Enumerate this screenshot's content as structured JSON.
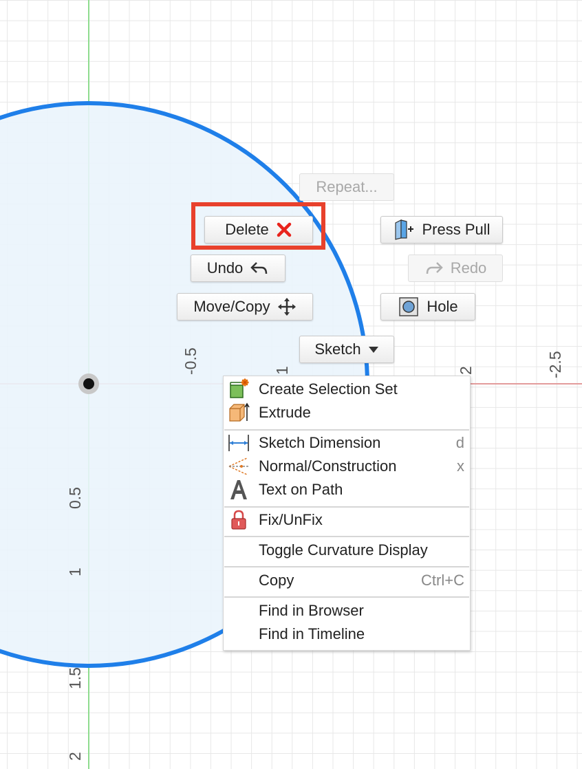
{
  "canvas": {
    "axis_labels": {
      "x": [
        "-0.5",
        "1",
        "2",
        "-2.5"
      ],
      "y": [
        "0.5",
        "1",
        "1.5",
        "2"
      ]
    },
    "colors": {
      "circle_stroke": "#1f7fe9",
      "circle_fill": "#eaf4fc",
      "vertical_axis": "#8fdc8f",
      "horizontal_axis": "#e39b9b",
      "grid": "#e7e7e7"
    }
  },
  "marking_menu": {
    "repeat": "Repeat...",
    "delete": "Delete",
    "press_pull": "Press Pull",
    "undo": "Undo",
    "redo": "Redo",
    "move_copy": "Move/Copy",
    "hole": "Hole",
    "sketch": "Sketch",
    "highlight_color": "#e8412c"
  },
  "context_menu": {
    "items": [
      {
        "label": "Create Selection Set",
        "shortcut": "",
        "icon": "selection-set-icon"
      },
      {
        "label": "Extrude",
        "shortcut": "",
        "icon": "extrude-icon"
      },
      {
        "label": "Sketch Dimension",
        "shortcut": "d",
        "icon": "dimension-icon"
      },
      {
        "label": "Normal/Construction",
        "shortcut": "x",
        "icon": "construction-icon"
      },
      {
        "label": "Text on Path",
        "shortcut": "",
        "icon": "text-icon"
      },
      {
        "label": "Fix/UnFix",
        "shortcut": "",
        "icon": "lock-icon"
      },
      {
        "label": "Toggle Curvature Display",
        "shortcut": "",
        "icon": ""
      },
      {
        "label": "Copy",
        "shortcut": "Ctrl+C",
        "icon": ""
      },
      {
        "label": "Find in Browser",
        "shortcut": "",
        "icon": ""
      },
      {
        "label": "Find in Timeline",
        "shortcut": "",
        "icon": ""
      }
    ]
  }
}
